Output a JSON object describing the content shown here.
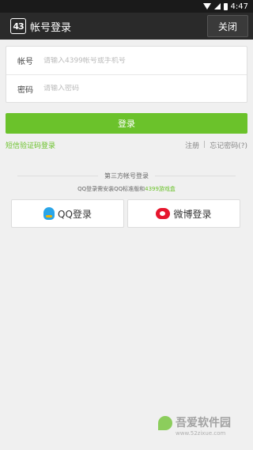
{
  "status_bar": {
    "time": "4:47"
  },
  "header": {
    "logo_text": "43",
    "title": "帐号登录",
    "close_label": "关闭"
  },
  "form": {
    "account": {
      "label": "帐号",
      "placeholder": "请输入4399帐号或手机号",
      "value": ""
    },
    "password": {
      "label": "密码",
      "placeholder": "请输入密码",
      "value": ""
    }
  },
  "login_button": "登录",
  "links": {
    "sms_login": "短信验证码登录",
    "register": "注册",
    "separator": "|",
    "forgot": "忘记密码(?)"
  },
  "third_party": {
    "title": "第三方帐号登录",
    "note_prefix": "QQ登录需安装QQ标准版和",
    "note_highlight": "4399游戏盒",
    "qq_label": "QQ登录",
    "weibo_label": "微博登录"
  },
  "watermark": {
    "name": "吾爱软件园",
    "url": "www.52zixue.com"
  },
  "colors": {
    "accent": "#6bc22b",
    "header_bg": "#2a2a2a",
    "qq_blue": "#2aa5e8",
    "weibo_red": "#e6162d"
  },
  "icons": [
    "wifi-icon",
    "signal-icon",
    "battery-icon",
    "game-box-logo-icon",
    "qq-icon",
    "weibo-icon"
  ]
}
